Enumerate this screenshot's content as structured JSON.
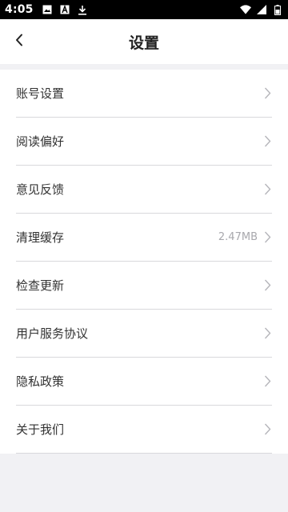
{
  "status_bar": {
    "time": "4:05",
    "left_icons": [
      "image-icon",
      "font-icon",
      "download-icon"
    ],
    "right_icons": [
      "wifi-icon",
      "signal-icon",
      "battery-icon"
    ]
  },
  "header": {
    "title": "设置",
    "back_icon": "back-arrow-icon"
  },
  "settings": {
    "items": [
      {
        "label": "账号设置",
        "value": ""
      },
      {
        "label": "阅读偏好",
        "value": ""
      },
      {
        "label": "意见反馈",
        "value": ""
      },
      {
        "label": "清理缓存",
        "value": "2.47MB"
      },
      {
        "label": "检查更新",
        "value": ""
      },
      {
        "label": "用户服务协议",
        "value": ""
      },
      {
        "label": "隐私政策",
        "value": ""
      },
      {
        "label": "关于我们",
        "value": ""
      }
    ]
  },
  "colors": {
    "background": "#f1f1f4",
    "divider": "#d8d8dc",
    "text_primary": "#333333",
    "text_muted": "#a8a8ad"
  }
}
